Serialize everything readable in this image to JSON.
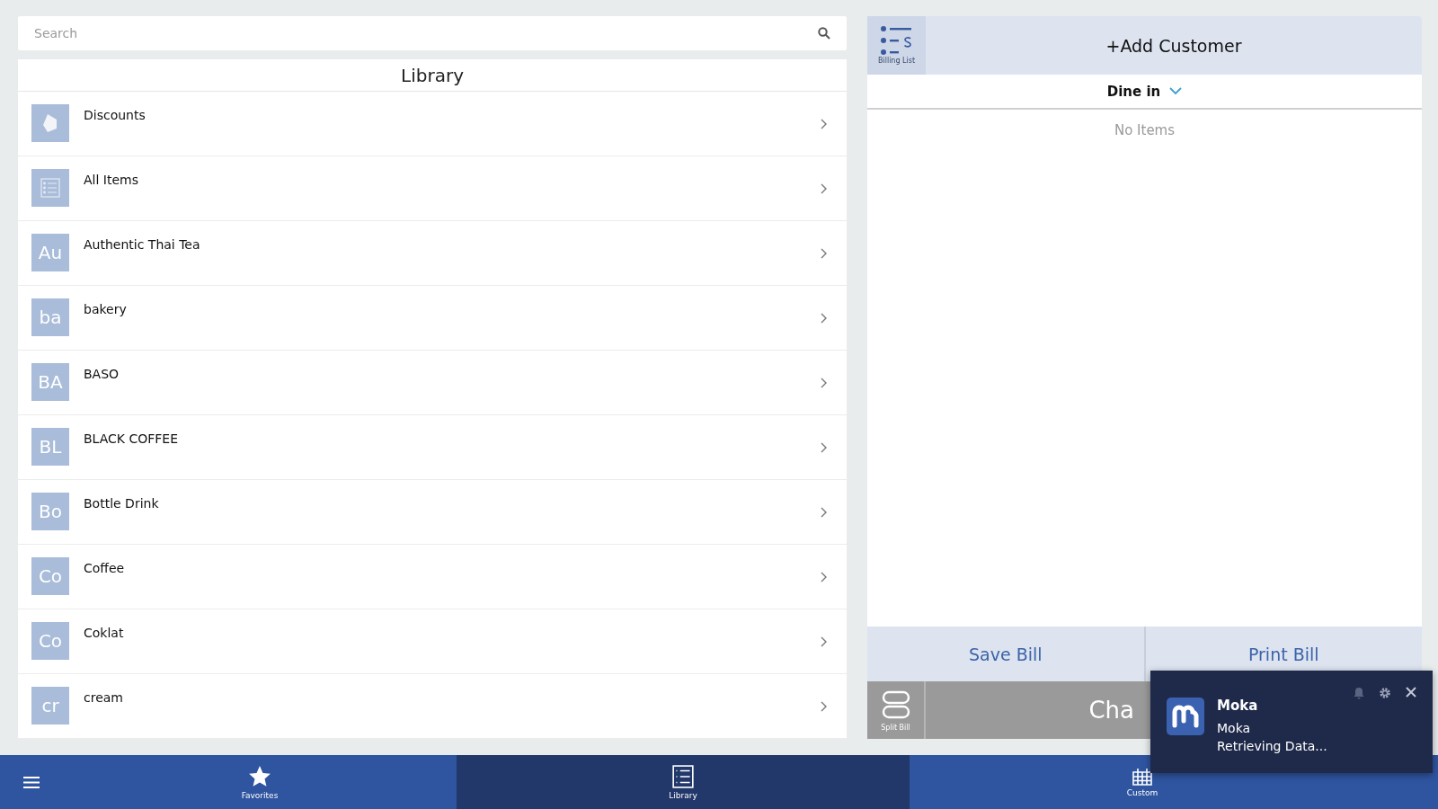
{
  "search": {
    "placeholder": "Search"
  },
  "library": {
    "title": "Library",
    "rows": [
      {
        "kind": "tag",
        "label": "Discounts"
      },
      {
        "kind": "list",
        "label": "All Items"
      },
      {
        "kind": "initials",
        "initials": "Au",
        "label": "Authentic Thai Tea"
      },
      {
        "kind": "initials",
        "initials": "ba",
        "label": "bakery"
      },
      {
        "kind": "initials",
        "initials": "BA",
        "label": "BASO"
      },
      {
        "kind": "initials",
        "initials": "BL",
        "label": "BLACK COFFEE"
      },
      {
        "kind": "initials",
        "initials": "Bo",
        "label": "Bottle Drink"
      },
      {
        "kind": "initials",
        "initials": "Co",
        "label": "Coffee"
      },
      {
        "kind": "initials",
        "initials": "Co",
        "label": "Coklat"
      },
      {
        "kind": "initials",
        "initials": "cr",
        "label": "cream"
      }
    ]
  },
  "bill": {
    "billing_list_label": "Billing List",
    "add_customer": "+Add Customer",
    "order_type": "Dine in",
    "empty": "No Items",
    "save": "Save Bill",
    "print": "Print Bill",
    "split_label": "Split Bill",
    "charge": "Cha"
  },
  "nav": [
    {
      "kind": "favorites",
      "label": "Favorites",
      "selected": false
    },
    {
      "kind": "library",
      "label": "Library",
      "selected": true
    },
    {
      "kind": "custom",
      "label": "Custom",
      "selected": false
    }
  ],
  "notification": {
    "app": "Moka",
    "title": "Moka",
    "message": "Retrieving Data..."
  }
}
